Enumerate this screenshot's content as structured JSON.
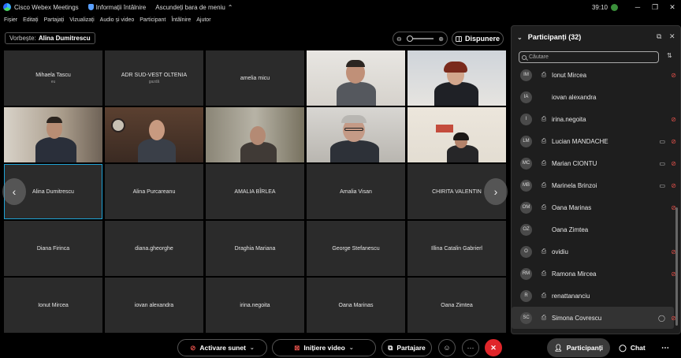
{
  "titlebar": {
    "app_title": "Cisco Webex Meetings",
    "meeting_info": "Informații întâlnire",
    "hide_menu": "Ascundeți bara de meniu",
    "timer": "39:10",
    "minimize": "─",
    "restore": "❐",
    "close": "✕"
  },
  "menu": [
    "Fișier",
    "Editați",
    "Partajați",
    "Vizualizați",
    "Audio și video",
    "Participant",
    "Întâlnire",
    "Ajutor"
  ],
  "speaker": {
    "label": "Vorbește:",
    "name": "Alina Dumitrescu"
  },
  "layout_button": "Dispunere",
  "tiles": [
    {
      "name": "Mihaela Tascu",
      "sub": "eu",
      "video": false
    },
    {
      "name": "ADR SUD-VEST OLTENIA",
      "sub": "gazdă",
      "video": false
    },
    {
      "name": "amelia micu",
      "sub": "",
      "video": false
    },
    {
      "name": "",
      "sub": "",
      "video": true
    },
    {
      "name": "",
      "sub": "",
      "video": true
    },
    {
      "name": "",
      "sub": "",
      "video": true
    },
    {
      "name": "",
      "sub": "",
      "video": true
    },
    {
      "name": "",
      "sub": "",
      "video": true
    },
    {
      "name": "",
      "sub": "",
      "video": true
    },
    {
      "name": "",
      "sub": "",
      "video": true
    },
    {
      "name": "Alina Dumitrescu",
      "sub": "",
      "video": false,
      "active": true
    },
    {
      "name": "Alina Purcareanu",
      "sub": "",
      "video": false
    },
    {
      "name": "AMALIA BÎRLEA",
      "sub": "",
      "video": false
    },
    {
      "name": "Amalia Visan",
      "sub": "",
      "video": false
    },
    {
      "name": "CHIRITA VALENTIN",
      "sub": "",
      "video": false
    },
    {
      "name": "Diana Firinca",
      "sub": "",
      "video": false
    },
    {
      "name": "diana.gheorghe",
      "sub": "",
      "video": false
    },
    {
      "name": "Draghia Mariana",
      "sub": "",
      "video": false
    },
    {
      "name": "George Stefanescu",
      "sub": "",
      "video": false
    },
    {
      "name": "Illina Catalin Gabrierl",
      "sub": "",
      "video": false
    },
    {
      "name": "Ionut Mircea",
      "sub": "",
      "video": false
    },
    {
      "name": "iovan alexandra",
      "sub": "",
      "video": false
    },
    {
      "name": "irina.negoita",
      "sub": "",
      "video": false
    },
    {
      "name": "Oana Marinas",
      "sub": "",
      "video": false
    },
    {
      "name": "Oana Zimtea",
      "sub": "",
      "video": false
    }
  ],
  "panel": {
    "title": "Participanți (32)",
    "search_placeholder": "Căutare",
    "participants": [
      {
        "initials": "IM",
        "name": "Ionut Mircea",
        "device": true,
        "camera": false,
        "muted": true,
        "chat": false
      },
      {
        "initials": "IA",
        "name": "iovan alexandra",
        "device": false,
        "camera": false,
        "muted": false,
        "chat": false
      },
      {
        "initials": "I",
        "name": "irina.negoita",
        "device": true,
        "camera": false,
        "muted": true,
        "chat": false
      },
      {
        "initials": "LM",
        "name": "Lucian MANDACHE",
        "device": true,
        "camera": true,
        "muted": true,
        "chat": false
      },
      {
        "initials": "MC",
        "name": "Marian CIONTU",
        "device": true,
        "camera": true,
        "muted": true,
        "chat": false
      },
      {
        "initials": "MB",
        "name": "Marinela Brinzoi",
        "device": true,
        "camera": true,
        "muted": true,
        "chat": false
      },
      {
        "initials": "OM",
        "name": "Oana Marinas",
        "device": true,
        "camera": false,
        "muted": true,
        "chat": false
      },
      {
        "initials": "OZ",
        "name": "Oana Zimtea",
        "device": false,
        "camera": false,
        "muted": false,
        "chat": false
      },
      {
        "initials": "O",
        "name": "ovidiu",
        "device": true,
        "camera": false,
        "muted": true,
        "chat": false
      },
      {
        "initials": "RM",
        "name": "Ramona Mircea",
        "device": true,
        "camera": false,
        "muted": true,
        "chat": false
      },
      {
        "initials": "R",
        "name": "renattananciu",
        "device": true,
        "camera": false,
        "muted": false,
        "chat": false
      },
      {
        "initials": "SC",
        "name": "Simona Covrescu",
        "device": true,
        "camera": false,
        "muted": true,
        "chat": true
      }
    ]
  },
  "toolbar": {
    "audio": "Activare sunet",
    "video": "Inițiere video",
    "share": "Partajare",
    "participants": "Participanți",
    "chat": "Chat"
  },
  "colors": {
    "accent": "#1fa3d6",
    "end": "#e0262a",
    "mute": "#e0504a"
  }
}
